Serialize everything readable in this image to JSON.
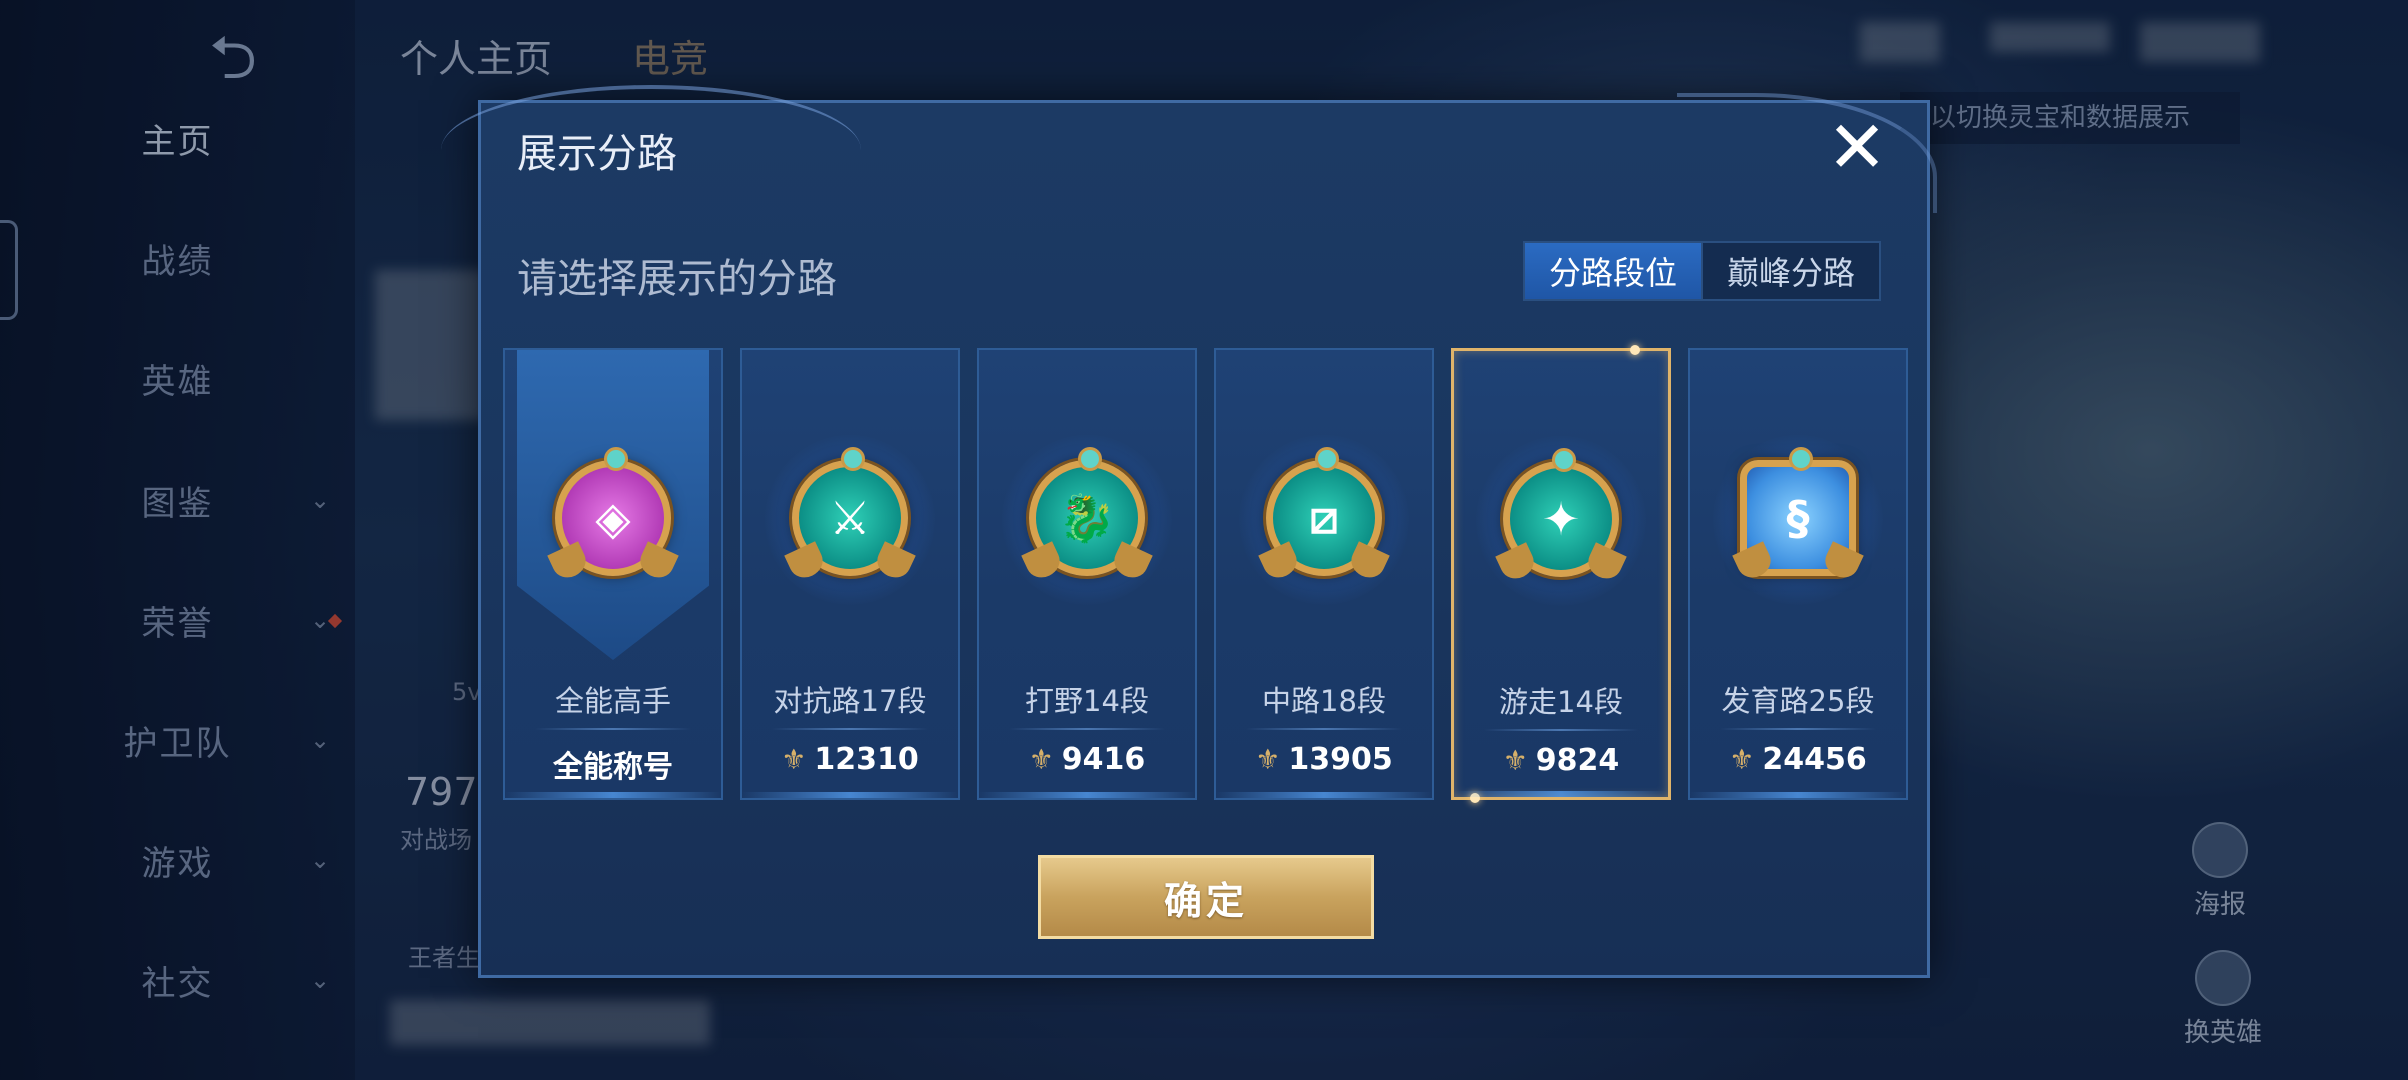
{
  "background": {
    "back_glyph": "⮌",
    "sidebar": [
      {
        "label": "主页",
        "active": true,
        "has_chevron": false
      },
      {
        "label": "战绩",
        "active": false,
        "has_chevron": false
      },
      {
        "label": "英雄",
        "active": false,
        "has_chevron": false
      },
      {
        "label": "图鉴",
        "active": false,
        "has_chevron": true
      },
      {
        "label": "荣誉",
        "active": false,
        "has_chevron": true
      },
      {
        "label": "护卫队",
        "active": false,
        "has_chevron": true
      },
      {
        "label": "游戏",
        "active": false,
        "has_chevron": true
      },
      {
        "label": "社交",
        "active": false,
        "has_chevron": true
      }
    ],
    "tabs": [
      "个人主页",
      "电竞"
    ],
    "hint_text": "以切换灵宝和数据展示",
    "number_text": "797",
    "sub_text": "对战场",
    "small_text_1": "5v",
    "small_text_2": "王者生",
    "right_btn_1": "海报",
    "right_btn_2": "换英雄"
  },
  "modal": {
    "title": "展示分路",
    "close_glyph": "✕",
    "subtitle": "请选择展示的分路",
    "segments": [
      {
        "label": "分路段位",
        "active": true
      },
      {
        "label": "巅峰分路",
        "active": false
      }
    ],
    "confirm_label": "确定"
  },
  "cards": [
    {
      "label": "全能高手",
      "value": "全能称号",
      "show_score_icon": false,
      "selected": false,
      "medal_color": "purple",
      "medal_icon": "all-round-icon",
      "medal_glyph": "◈"
    },
    {
      "label": "对抗路17段",
      "value": "12310",
      "show_score_icon": true,
      "selected": false,
      "medal_color": "teal",
      "medal_icon": "clash-lane-icon",
      "medal_glyph": "⚔"
    },
    {
      "label": "打野14段",
      "value": "9416",
      "show_score_icon": true,
      "selected": false,
      "medal_color": "teal",
      "medal_icon": "jungle-dragon-icon",
      "medal_glyph": "🐉"
    },
    {
      "label": "中路18段",
      "value": "13905",
      "show_score_icon": true,
      "selected": false,
      "medal_color": "teal",
      "medal_icon": "mid-lane-icon",
      "medal_glyph": "⧄"
    },
    {
      "label": "游走14段",
      "value": "9824",
      "show_score_icon": true,
      "selected": true,
      "medal_color": "teal",
      "medal_icon": "roam-wings-icon",
      "medal_glyph": "✦"
    },
    {
      "label": "发育路25段",
      "value": "24456",
      "show_score_icon": true,
      "selected": false,
      "medal_color": "blue",
      "medal_icon": "farm-lane-icon",
      "medal_glyph": "§"
    }
  ],
  "colors": {
    "accent_gold": "#e0b46a",
    "segment_active": "#2b6bc2",
    "modal_bg": "#1c3a64"
  }
}
